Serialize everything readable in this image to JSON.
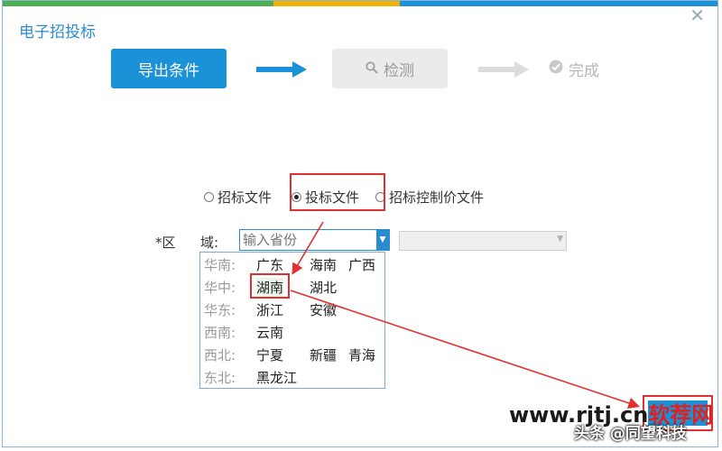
{
  "dialog": {
    "title": "电子招投标",
    "close_glyph": "✕",
    "topbar_colors": [
      "#4caf50",
      "#f0b400",
      "#1b92d8"
    ]
  },
  "steps": {
    "export": "导出条件",
    "check": "检测",
    "done": "完成",
    "check_icon": "search-icon",
    "done_icon": "check-circle-icon",
    "arrow_active_color": "#1b92d8",
    "arrow_inactive_color": "#dcdcdc"
  },
  "file_types": [
    {
      "label": "招标文件",
      "checked": false
    },
    {
      "label": "投标文件",
      "checked": true
    },
    {
      "label": "招标控制价文件",
      "checked": false
    }
  ],
  "region": {
    "label_prefix": "*区",
    "label_suffix": "域:",
    "province_placeholder": "输入省份"
  },
  "province_groups": [
    {
      "region": "华南:",
      "provinces": [
        "广东",
        "海南",
        "广西"
      ]
    },
    {
      "region": "华中:",
      "provinces": [
        "湖南",
        "湖北"
      ]
    },
    {
      "region": "华东:",
      "provinces": [
        "浙江",
        "安徽"
      ]
    },
    {
      "region": "西南:",
      "provinces": [
        "云南"
      ]
    },
    {
      "region": "西北:",
      "provinces": [
        "宁夏",
        "新疆",
        "青海"
      ]
    },
    {
      "region": "东北:",
      "provinces": [
        "黑龙江"
      ]
    }
  ],
  "watermark": {
    "site_prefix": "www.rjtj.cn",
    "site_suffix": "软荐网",
    "credit": "头条 @同望科技"
  },
  "colors": {
    "accent": "#1b92d8",
    "highlight": "#e03030",
    "title": "#2a8bd0"
  }
}
